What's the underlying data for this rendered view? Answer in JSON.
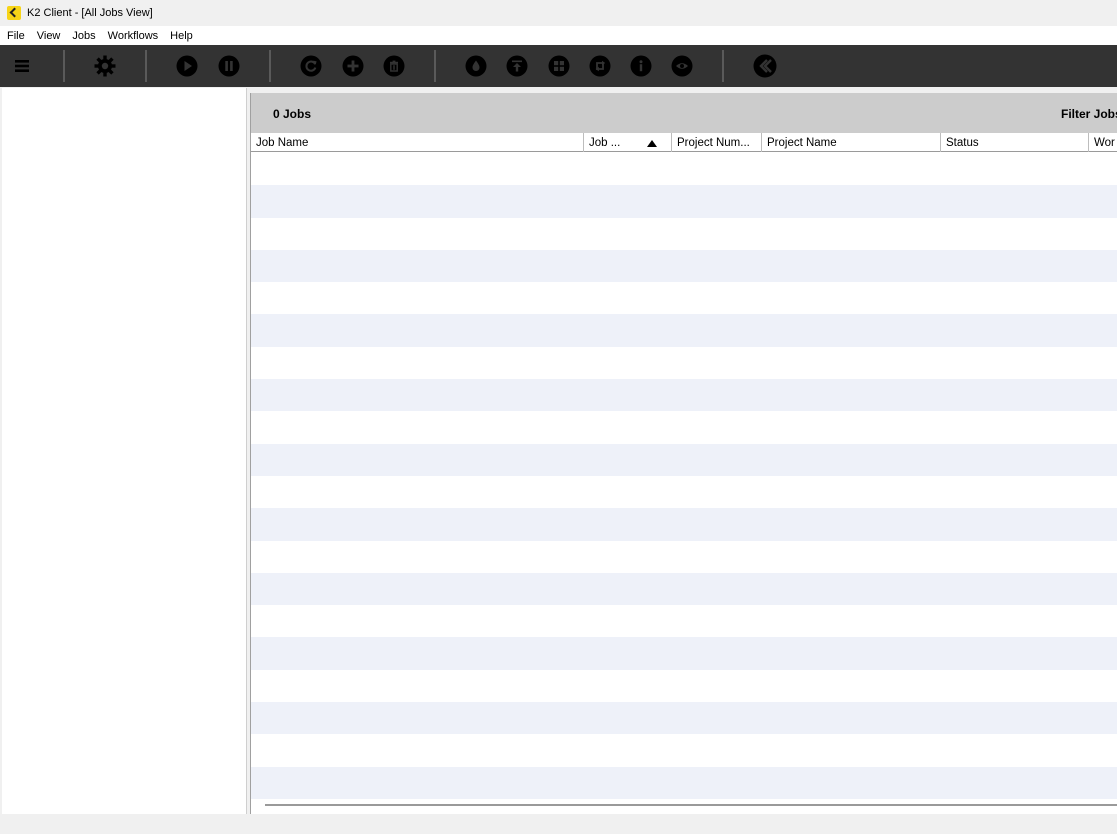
{
  "window": {
    "title": "K2 Client - [All Jobs View]"
  },
  "menu": [
    {
      "label": "File"
    },
    {
      "label": "View"
    },
    {
      "label": "Jobs"
    },
    {
      "label": "Workflows"
    },
    {
      "label": "Help"
    }
  ],
  "toolbar": {
    "icons": [
      "hamburger-menu-icon",
      "settings-gear-icon",
      "play-icon",
      "pause-icon",
      "refresh-icon",
      "add-icon",
      "delete-icon",
      "ink-drop-icon",
      "upload-icon",
      "grid-icon",
      "swap-icon",
      "info-icon",
      "preview-eye-icon",
      "k2-logo-icon"
    ],
    "icon_color": "#333333",
    "icon_fill": "#000000",
    "background": "#333333"
  },
  "jobs": {
    "count_label": "0 Jobs",
    "filter_label": "Filter Jobs"
  },
  "table": {
    "columns": [
      {
        "label": "Job Name"
      },
      {
        "label": "Job ..."
      },
      {
        "label": "Project Num..."
      },
      {
        "label": "Project Name"
      },
      {
        "label": "Status"
      },
      {
        "label": "Wor"
      }
    ],
    "sorted_column": "Job ...",
    "sort_direction": "ascending",
    "rows": [],
    "stripe_color": "#eef1f9"
  }
}
